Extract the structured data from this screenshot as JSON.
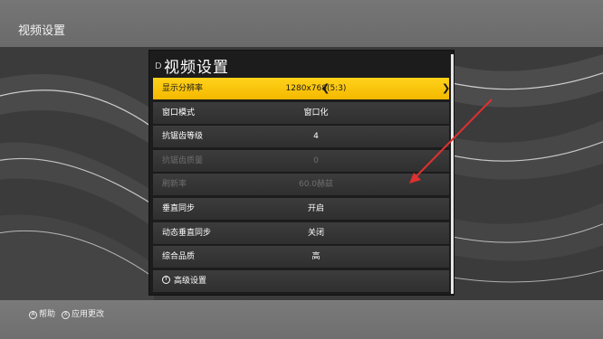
{
  "window": {
    "title": "视频设置"
  },
  "panel": {
    "title": "视频设置",
    "title_icon": "D",
    "rows": [
      {
        "label": "显示分辨率",
        "value": "1280x768(5:3)"
      },
      {
        "label": "窗口模式",
        "value": "窗口化"
      },
      {
        "label": "抗锯齿等级",
        "value": "4"
      },
      {
        "label": "抗锯齿质量",
        "value": "0"
      },
      {
        "label": "刷新率",
        "value": "60.0赫兹"
      },
      {
        "label": "垂直同步",
        "value": "开启"
      },
      {
        "label": "动态垂直同步",
        "value": "关闭"
      },
      {
        "label": "综合品质",
        "value": "高"
      },
      {
        "label": "高级设置",
        "value": ""
      }
    ],
    "advanced_icon": "Y"
  },
  "footer": {
    "help_glyph": "A",
    "help_label": "帮助",
    "apply_glyph": "X",
    "apply_label": "应用更改"
  },
  "colors": {
    "accent": "#f5b800",
    "annotation_arrow": "#e03030"
  }
}
